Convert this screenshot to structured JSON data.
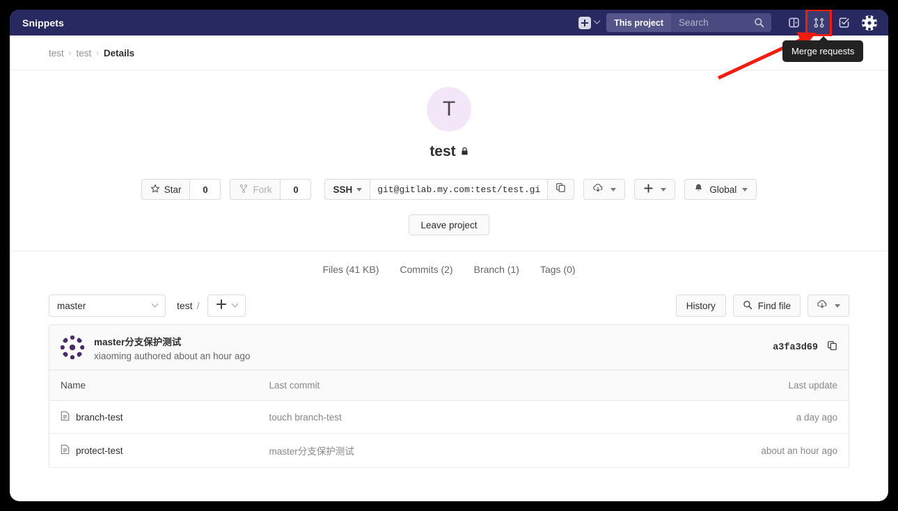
{
  "navbar": {
    "brand": "Snippets",
    "create_icon": "plus-square-icon",
    "search": {
      "scope": "This project",
      "placeholder": "Search",
      "icon": "search-icon"
    },
    "icons": [
      {
        "name": "issues-icon",
        "label": "Issues"
      },
      {
        "name": "merge-requests-icon",
        "label": "Merge requests",
        "highlighted": true
      },
      {
        "name": "todos-icon",
        "label": "Todos"
      }
    ],
    "avatar": "user-avatar-identicon",
    "tooltip": "Merge requests",
    "highlight_color": "#f01e0e",
    "background_color": "#292961"
  },
  "breadcrumb": {
    "items": [
      "test",
      "test"
    ],
    "current": "Details",
    "separator": "›"
  },
  "project": {
    "avatar_letter": "T",
    "avatar_color": "#f3e6f8",
    "name": "test",
    "visibility_icon": "lock-icon",
    "actions": {
      "star_label": "Star",
      "star_icon": "star-icon",
      "star_count": "0",
      "fork_label": "Fork",
      "fork_icon": "fork-icon",
      "fork_count": "0",
      "clone_protocol": "SSH",
      "clone_url": "git@gitlab.my.com:test/test.gi",
      "copy_icon": "copy-icon",
      "download_icon": "download-icon",
      "add_icon": "plus-icon",
      "notification_icon": "bell-icon",
      "notification_label": "Global",
      "leave_label": "Leave project"
    },
    "stats": [
      {
        "label": "Files (41 KB)"
      },
      {
        "label": "Commits (2)"
      },
      {
        "label": "Branch (1)"
      },
      {
        "label": "Tags (0)"
      }
    ]
  },
  "repo": {
    "branch": "master",
    "path": "test",
    "path_separator": "/",
    "add_icon": "plus-icon",
    "history_label": "History",
    "find_file_label": "Find file",
    "find_file_icon": "search-icon",
    "download_icon": "download-icon",
    "last_commit": {
      "avatar": "commit-author-identicon",
      "title": "master分支保护测试",
      "meta": "xiaoming authored about an hour ago",
      "hash": "a3fa3d69",
      "copy_icon": "copy-icon"
    },
    "table": {
      "headers": [
        "Name",
        "Last commit",
        "Last update"
      ],
      "rows": [
        {
          "icon": "file-icon",
          "name": "branch-test",
          "commit": "touch branch-test",
          "update": "a day ago"
        },
        {
          "icon": "file-icon",
          "name": "protect-test",
          "commit": "master分支保护测试",
          "update": "about an hour ago"
        }
      ]
    }
  }
}
